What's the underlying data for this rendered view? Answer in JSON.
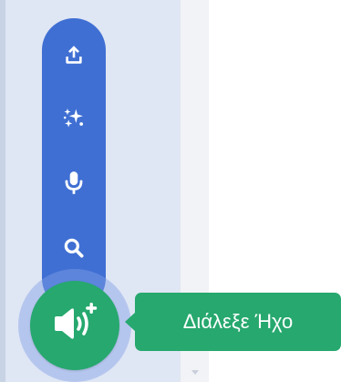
{
  "sound_menu": {
    "items": [
      {
        "id": "upload",
        "icon": "upload-icon"
      },
      {
        "id": "surprise",
        "icon": "sparkle-icon"
      },
      {
        "id": "record",
        "icon": "microphone-icon"
      },
      {
        "id": "search",
        "icon": "search-icon"
      }
    ],
    "main_button": {
      "icon": "add-sound-icon"
    },
    "tooltip": {
      "text": "Διάλεξε Ήχο"
    }
  },
  "colors": {
    "menu_blue": "#3f6fd3",
    "main_green": "#26a86e",
    "panel_bg": "#dfe6f4",
    "halo": "#8aa5e6"
  }
}
